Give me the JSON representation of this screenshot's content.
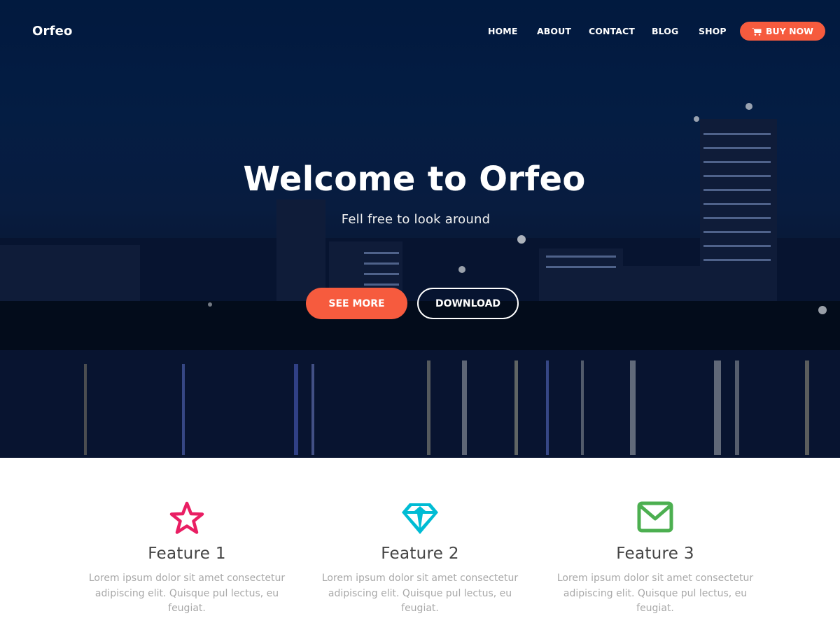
{
  "brand": {
    "name": "Orfeo"
  },
  "nav": {
    "links": [
      {
        "label": "HOME"
      },
      {
        "label": "ABOUT"
      },
      {
        "label": "CONTACT"
      },
      {
        "label": "BLOG"
      },
      {
        "label": "SHOP"
      }
    ],
    "buy_button": {
      "label": "BUY NOW",
      "icon": "cart-icon"
    }
  },
  "hero": {
    "title": "Welcome to Orfeo",
    "subtitle": "Fell free to look around",
    "primary_button": "SEE MORE",
    "secondary_button": "DOWNLOAD",
    "background": "night city skyline reflected in water"
  },
  "features": [
    {
      "icon": "star-icon",
      "title": "Feature 1",
      "text": "Lorem ipsum dolor sit amet consectetur adipiscing elit. Quisque pul lectus, eu feugiat.",
      "color": "#e91e63"
    },
    {
      "icon": "diamond-icon",
      "title": "Feature 2",
      "text": "Lorem ipsum dolor sit amet consectetur adipiscing elit. Quisque pul lectus, eu feugiat.",
      "color": "#00bcd4"
    },
    {
      "icon": "envelope-icon",
      "title": "Feature 3",
      "text": "Lorem ipsum dolor sit amet consectetur adipiscing elit. Quisque pul lectus, eu feugiat.",
      "color": "#4caf50"
    }
  ],
  "colors": {
    "accent": "#f65b3e",
    "hero_bg": "#021c44"
  }
}
